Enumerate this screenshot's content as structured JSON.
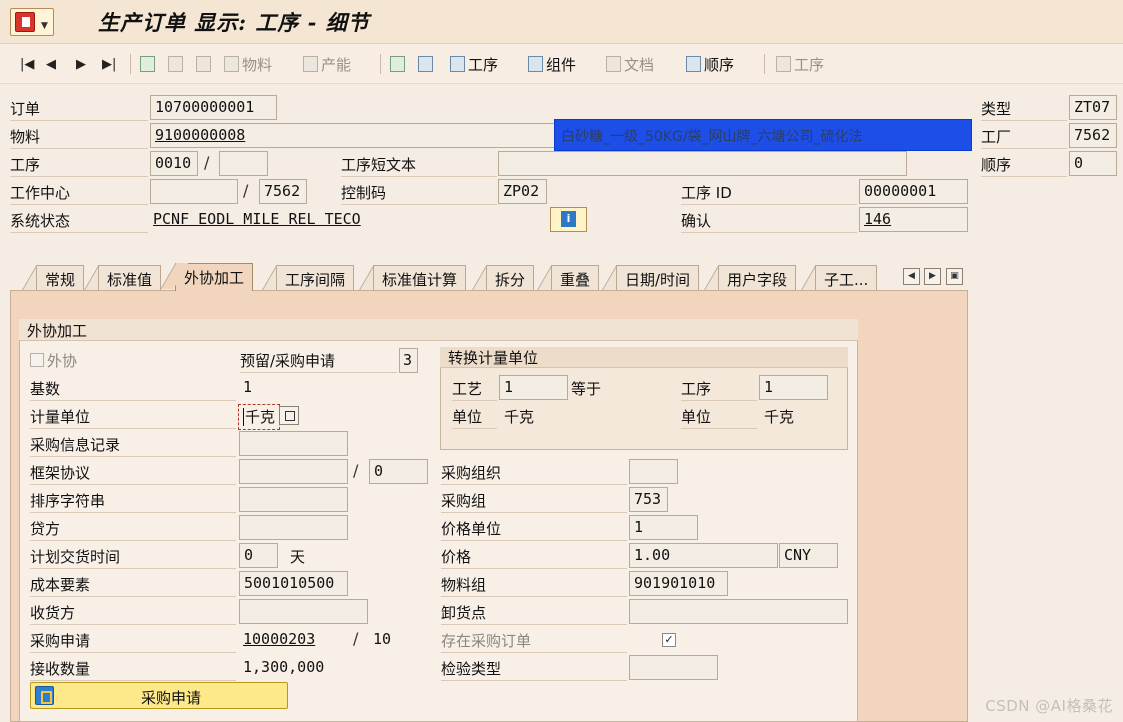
{
  "title": "生产订单 显示: 工序 - 细节",
  "toolbar": {
    "material": "物料",
    "capacity": "产能",
    "operation": "工序",
    "component": "组件",
    "document": "文档",
    "sequence": "顺序",
    "operation2": "工序"
  },
  "header": {
    "order_label": "订单",
    "order_value": "10700000001",
    "material_label": "物料",
    "material_value": "9100000008",
    "material_text": "白砂糖_一级_50KG/袋_网山牌_六塘公司_硫化法",
    "operation_label": "工序",
    "operation_value": "0010",
    "operation_sub": "",
    "op_short_text_label": "工序短文本",
    "op_short_text_value": "",
    "work_center_label": "工作中心",
    "work_center_value": "",
    "work_center_plant": "7562",
    "control_key_label": "控制码",
    "control_key_value": "ZP02",
    "op_id_label": "工序 ID",
    "op_id_value": "00000001",
    "sys_status_label": "系统状态",
    "sys_status_value": "PCNF  EODL  MILE  REL   TECO",
    "confirm_label": "确认",
    "confirm_value": "146",
    "type_label": "类型",
    "type_value": "ZT07",
    "plant_label": "工厂",
    "plant_value": "7562",
    "sequence_label": "顺序",
    "sequence_value": "0"
  },
  "tabs": [
    {
      "label": "常规"
    },
    {
      "label": "标准值"
    },
    {
      "label": "外协加工"
    },
    {
      "label": "工序间隔"
    },
    {
      "label": "标准值计算"
    },
    {
      "label": "拆分"
    },
    {
      "label": "重叠"
    },
    {
      "label": "日期/时间"
    },
    {
      "label": "用户字段"
    },
    {
      "label": "子工..."
    }
  ],
  "subcontracting": {
    "group_title": "外协加工",
    "external_label": "外协",
    "external_checked": false,
    "reservation_label": "预留/采购申请",
    "reservation_value": "3",
    "base_qty_label": "基数",
    "base_qty_value": "1",
    "unit_label": "计量单位",
    "unit_value": "千克",
    "info_record_label": "采购信息记录",
    "info_record_value": "",
    "outline_label": "框架协议",
    "outline_value": "",
    "outline_item": "0",
    "sort_string_label": "排序字符串",
    "sort_string_value": "",
    "vendor_label": "贷方",
    "vendor_value": "",
    "delivery_time_label": "计划交货时间",
    "delivery_time_value": "0",
    "delivery_time_unit": "天",
    "cost_element_label": "成本要素",
    "cost_element_value": "5001010500",
    "recipient_label": "收货方",
    "recipient_value": "",
    "pr_label": "采购申请",
    "pr_value": "10000203",
    "pr_item": "10",
    "received_qty_label": "接收数量",
    "received_qty_value": "1,300,000",
    "purch_org_label": "采购组织",
    "purch_org_value": "",
    "purch_group_label": "采购组",
    "purch_group_value": "753",
    "price_unit_label": "价格单位",
    "price_unit_value": "1",
    "price_label": "价格",
    "price_value": "1.00",
    "currency_value": "CNY",
    "mat_group_label": "物料组",
    "mat_group_value": "901901010",
    "unloading_label": "卸货点",
    "unloading_value": "",
    "po_exists_label": "存在采购订单",
    "po_exists_checked": true,
    "insp_type_label": "检验类型",
    "insp_type_value": "",
    "pr_button_label": "采购申请"
  },
  "conversion": {
    "title": "转换计量单位",
    "routing_label": "工艺",
    "routing_value": "1",
    "equals_label": "等于",
    "operation_label": "工序",
    "operation_value": "1",
    "unit_label_left": "单位",
    "unit_value_left": "千克",
    "unit_label_right": "单位",
    "unit_value_right": "千克"
  },
  "watermark": "CSDN @AI格桑花"
}
